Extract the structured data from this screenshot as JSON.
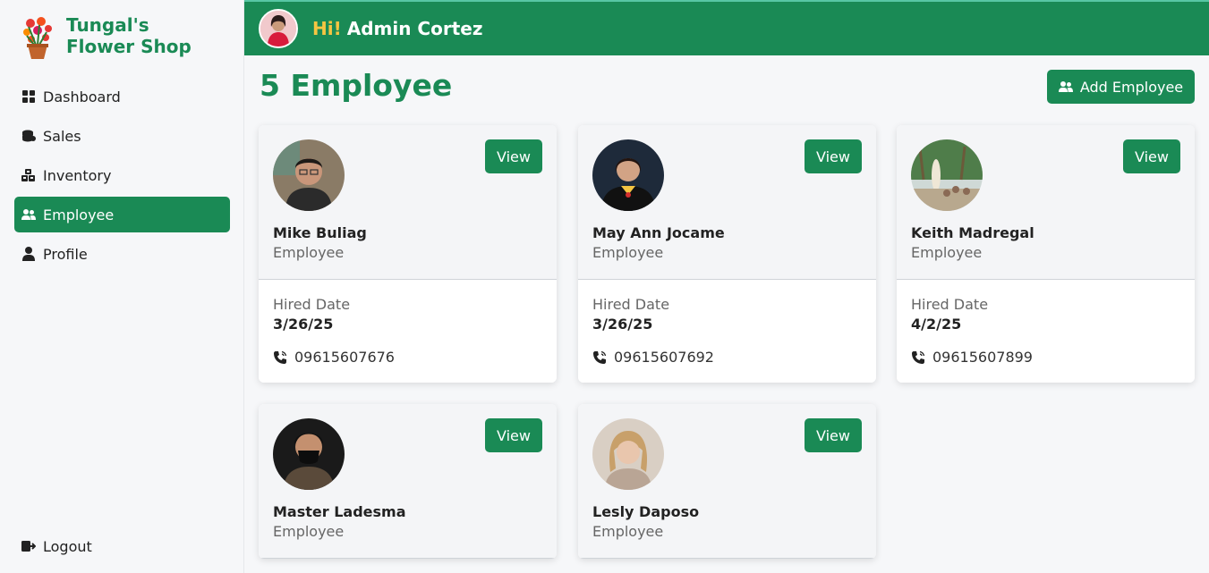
{
  "brand": {
    "name": "Tungal's Flower Shop"
  },
  "sidebar": {
    "items": [
      {
        "label": "Dashboard",
        "icon": "dashboard-icon"
      },
      {
        "label": "Sales",
        "icon": "coins-icon"
      },
      {
        "label": "Inventory",
        "icon": "boxes-icon"
      },
      {
        "label": "Employee",
        "icon": "users-icon",
        "active": true
      },
      {
        "label": "Profile",
        "icon": "user-icon"
      }
    ],
    "logout": "Logout"
  },
  "header": {
    "hi": "Hi!",
    "user": "Admin Cortez"
  },
  "main": {
    "title": "5 Employee",
    "add_button": "Add Employee",
    "view_label": "View",
    "hired_label": "Hired Date"
  },
  "employees": [
    {
      "name": "Mike Buliag",
      "role": "Employee",
      "hired": "3/26/25",
      "phone": "09615607676"
    },
    {
      "name": "May Ann Jocame",
      "role": "Employee",
      "hired": "3/26/25",
      "phone": "09615607692"
    },
    {
      "name": "Keith Madregal",
      "role": "Employee",
      "hired": "4/2/25",
      "phone": "09615607899"
    },
    {
      "name": "Master Ladesma",
      "role": "Employee",
      "hired": "",
      "phone": ""
    },
    {
      "name": "Lesly Daposo",
      "role": "Employee",
      "hired": "",
      "phone": ""
    }
  ],
  "colors": {
    "accent": "#1a8a55",
    "greeting": "#f5c542",
    "background": "#f6f7f9"
  }
}
